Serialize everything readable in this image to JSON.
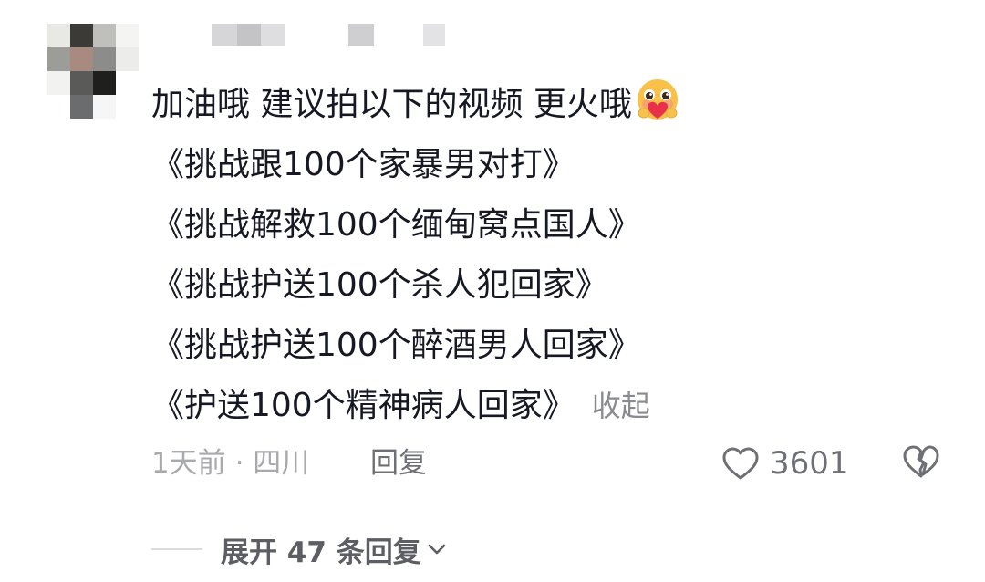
{
  "comment": {
    "avatar_icon": "pixelated-avatar",
    "lines": [
      "加油哦 建议拍以下的视频 更火哦",
      "《挑战跟100个家暴男对打》",
      "《挑战解救100个缅甸窝点国人》",
      "《挑战护送100个杀人犯回家》",
      "《挑战护送100个醉酒男人回家》",
      "《护送100个精神病人回家》"
    ],
    "emoji_icon": "blushing-heart-emoji-icon",
    "collapse_label": "收起",
    "time_location": "1天前 · 四川",
    "reply_label": "回复",
    "like_icon": "heart-outline-icon",
    "like_count": "3601",
    "dislike_icon": "broken-heart-icon",
    "expand_label": "展开 47 条回复",
    "expand_icon": "chevron-down-icon"
  },
  "colors": {
    "text": "#161823",
    "muted": "#a8a9ad",
    "secondary": "#6f7076",
    "collapse": "#8a8b91"
  }
}
